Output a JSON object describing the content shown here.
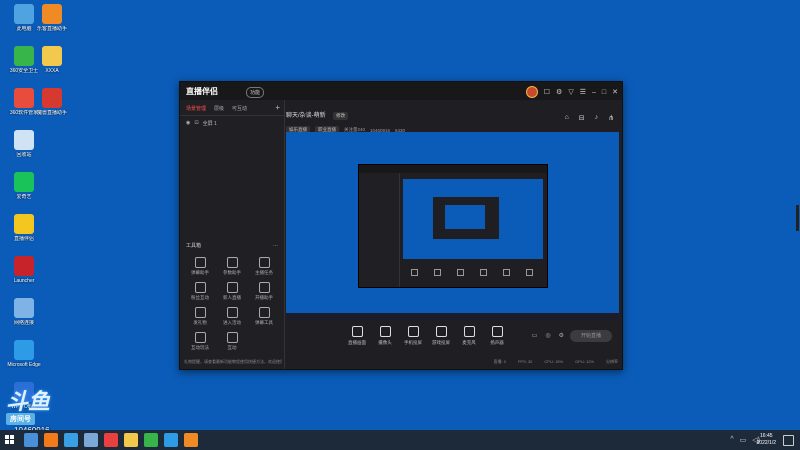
{
  "desktop": {
    "icons": [
      {
        "label": "此电脑",
        "name": "this-pc",
        "color": "#4fa3e0"
      },
      {
        "label": "乐客直播助手",
        "name": "lekee-assistant",
        "color": "#f08a24"
      },
      {
        "label": "360安全卫士",
        "name": "360-security",
        "color": "#38b54a"
      },
      {
        "label": "XXXA",
        "name": "folder-xxxa",
        "color": "#f2c94c"
      },
      {
        "label": "360软件管家",
        "name": "360-software",
        "color": "#e84c3d"
      },
      {
        "label": "魔兽直播助手",
        "name": "wow-assistant",
        "color": "#d6392f"
      },
      {
        "label": "回收站",
        "name": "recycle-bin",
        "color": "#cfe3f5"
      },
      {
        "label": "爱奇艺",
        "name": "iqiyi",
        "color": "#19c35a"
      },
      {
        "label": "直播伴侣",
        "name": "live-companion",
        "color": "#f3c620"
      },
      {
        "label": "Launcher",
        "name": "launcher",
        "color": "#c6232b"
      },
      {
        "label": "网络连接",
        "name": "network",
        "color": "#7fb3e6"
      },
      {
        "label": "Microsoft Edge",
        "name": "edge",
        "color": "#2e9be6"
      },
      {
        "label": "WPS Office",
        "name": "wps",
        "color": "#2b6fd6"
      }
    ]
  },
  "app": {
    "logo": "直播伴侣",
    "logo_badge": "功能",
    "title_icons": [
      "message-icon",
      "settings-icon",
      "shirt-icon",
      "skin-icon",
      "minimize-icon",
      "maximize-icon",
      "close-icon"
    ],
    "left_tabs": [
      "场景管理",
      "层级",
      "可互动"
    ],
    "plus": "+",
    "scene_label": "全屏 1",
    "toolbox": {
      "title": "工具箱",
      "more": "…"
    },
    "tools": [
      "弹幕助手",
      "参数助手",
      "主播任务",
      "粉丝互动",
      "新人直播",
      "开播助手",
      "发礼物",
      "进入活动",
      "弹幕工具",
      "互动玩法",
      "互动"
    ],
    "notice": "礼物提醒，请查看最新功能教程使用快捷方法，欢迎使用",
    "stream_title": "聊天/杂谈-萌新",
    "edit_label": "修改",
    "meta": {
      "tag1": "娱乐直播",
      "tag2": "职业直播",
      "fans": "关注量240",
      "room_id": "10460916",
      "hot": "6430"
    },
    "main_icons": [
      "share-room-icon",
      "lock-icon",
      "bell-icon",
      "share-icon"
    ],
    "controls": [
      "直播画面",
      "摄像头",
      "手机投屏",
      "游戏投屏",
      "麦克风",
      "扬声器"
    ],
    "golive_label": "开始直播",
    "status": [
      "直播: 0",
      "FPS: 30",
      "CPU: 15%",
      "GPU: 12%",
      "分辨率"
    ]
  },
  "watermark": {
    "brand": "斗鱼",
    "room_label": "房间号",
    "room_id": "10460916"
  },
  "taskbar": {
    "apps": [
      {
        "name": "search-app",
        "color": "#4a90d9"
      },
      {
        "name": "browser-app",
        "color": "#f27a1a"
      },
      {
        "name": "qq-browser-app",
        "color": "#3aa0e6"
      },
      {
        "name": "monitor-app",
        "color": "#7aa9d8"
      },
      {
        "name": "mail-app",
        "color": "#e84040"
      },
      {
        "name": "explorer-app",
        "color": "#f2c94c"
      },
      {
        "name": "green-app",
        "color": "#38b54a"
      },
      {
        "name": "edge-app",
        "color": "#2e9be6"
      },
      {
        "name": "live-app",
        "color": "#f08a24"
      }
    ],
    "time": "16:45",
    "date": "2022/1/2"
  }
}
